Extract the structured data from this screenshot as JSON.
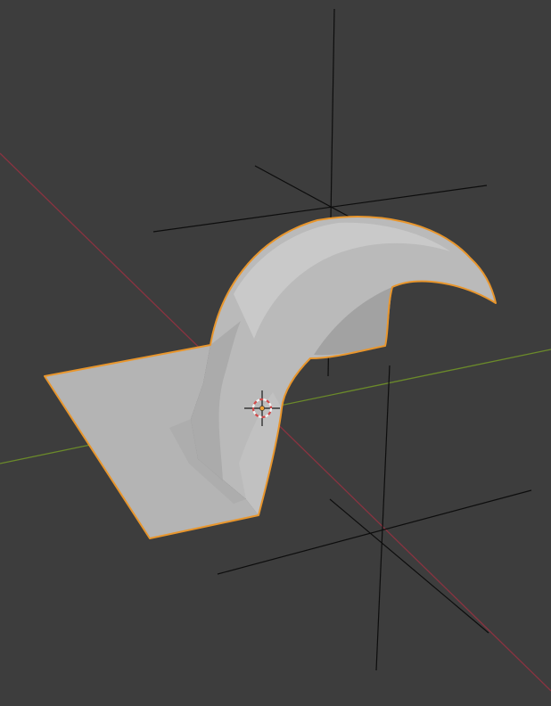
{
  "app": "3D viewport",
  "colors": {
    "background": "#3d3d3d",
    "x_axis": "#8a3340",
    "y_axis": "#6b8a2a",
    "empty_lines": "#0d0d0d",
    "mesh_fill": "#b7b7b7",
    "mesh_shadow": "#9a9a9a",
    "mesh_highlight": "#d2d2d2",
    "selection_outline": "#e8962d",
    "cursor_red": "#d24a4a",
    "cursor_white": "#f2f2f2",
    "origin_dot": "#f0a030"
  },
  "scene": {
    "objects": [
      {
        "name": "",
        "kind": "mesh",
        "selected": true
      },
      {
        "name": "",
        "kind": "empty-plain-axes",
        "selected": false
      },
      {
        "name": "",
        "kind": "empty-plain-axes",
        "selected": false
      }
    ],
    "icons": {
      "cursor": "3d-cursor-icon",
      "origin": "object-origin-icon"
    }
  }
}
